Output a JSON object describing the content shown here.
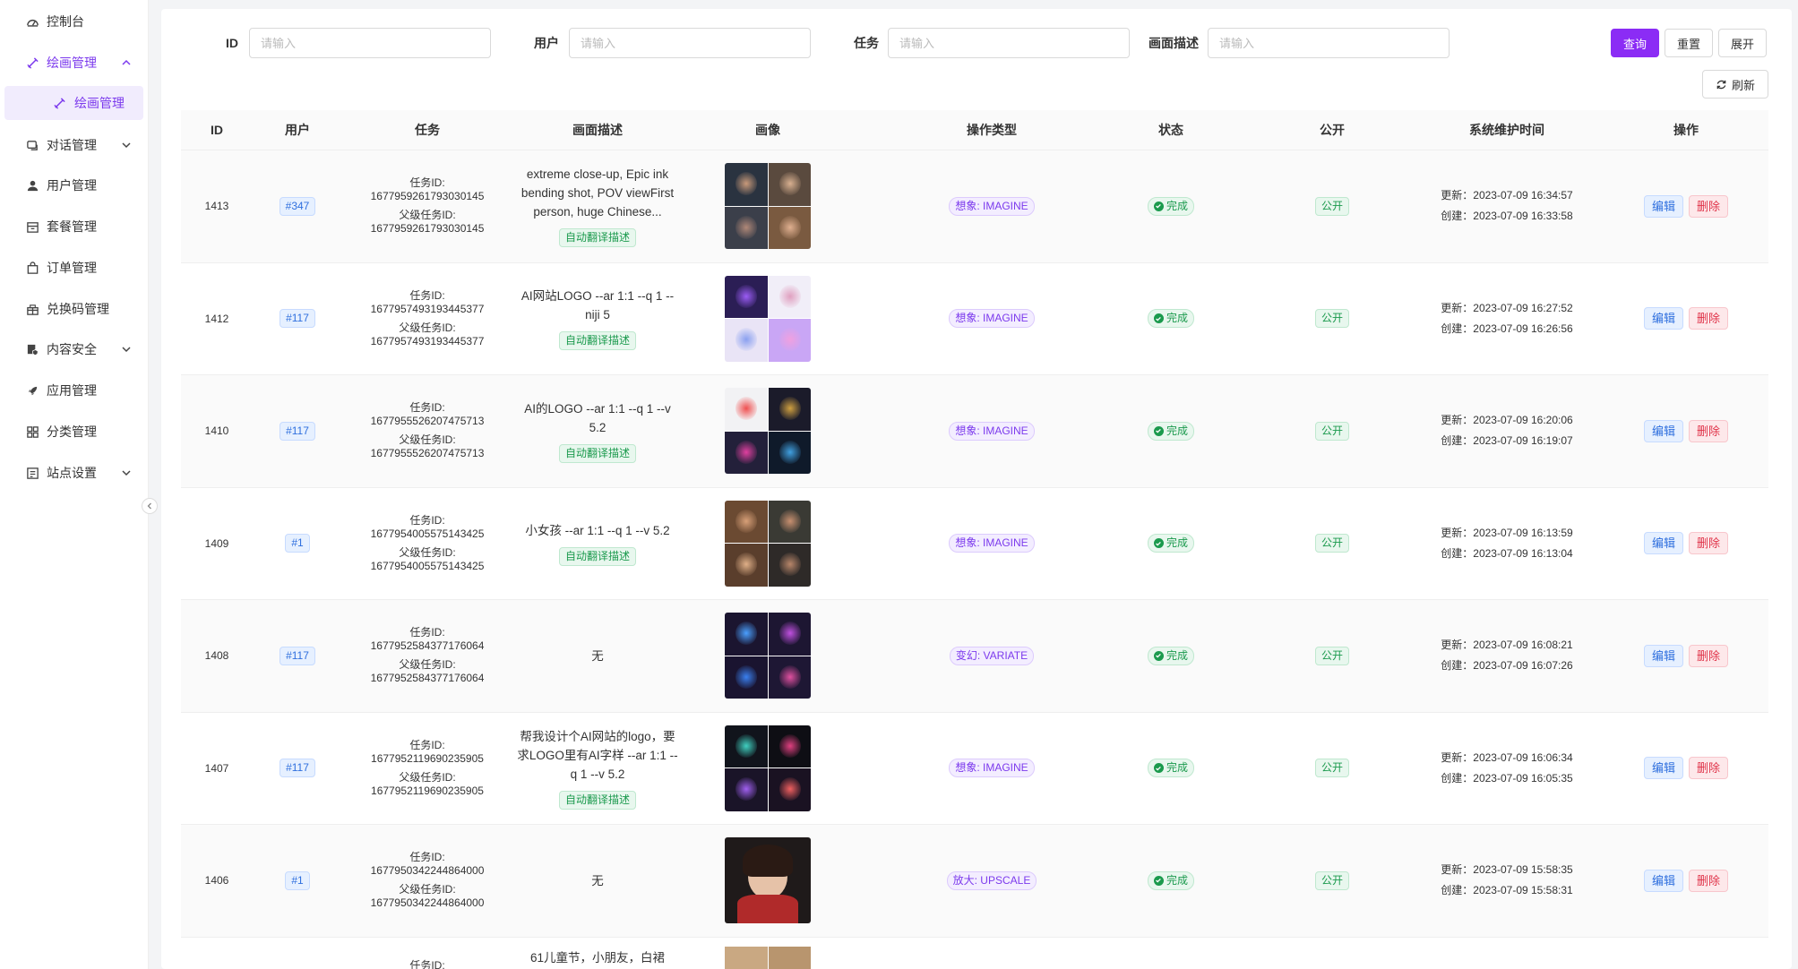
{
  "sidebar": {
    "items": [
      {
        "label": "控制台",
        "icon": "dashboard-icon"
      },
      {
        "label": "绘画管理",
        "icon": "brush-icon",
        "active": true,
        "expanded": true
      },
      {
        "label": "对话管理",
        "icon": "chat-icon",
        "has_children": true
      },
      {
        "label": "用户管理",
        "icon": "user-icon"
      },
      {
        "label": "套餐管理",
        "icon": "package-icon"
      },
      {
        "label": "订单管理",
        "icon": "bag-icon"
      },
      {
        "label": "兑换码管理",
        "icon": "gift-icon"
      },
      {
        "label": "内容安全",
        "icon": "shield-icon",
        "has_children": true
      },
      {
        "label": "应用管理",
        "icon": "rocket-icon"
      },
      {
        "label": "分类管理",
        "icon": "grid-icon"
      },
      {
        "label": "站点设置",
        "icon": "settings-icon",
        "has_children": true
      }
    ],
    "submenu_active": "绘画管理"
  },
  "filters": {
    "id_label": "ID",
    "user_label": "用户",
    "task_label": "任务",
    "desc_label": "画面描述",
    "placeholder": "请输入"
  },
  "buttons": {
    "query": "查询",
    "reset": "重置",
    "expand": "展开",
    "refresh": "刷新"
  },
  "colors": {
    "accent": "#8b2cf5",
    "success": "#1b9a4d",
    "link": "#2f6fde",
    "danger": "#e0344a"
  },
  "table": {
    "headers": [
      "ID",
      "用户",
      "任务",
      "画面描述",
      "画像",
      "操作类型",
      "状态",
      "公开",
      "系统维护时间",
      "操作"
    ],
    "task_id_label": "任务ID:",
    "parent_task_id_label": "父级任务ID:",
    "auto_translate_label": "自动翻译描述",
    "status_done": "完成",
    "public_label": "公开",
    "updated_prefix": "更新：",
    "created_prefix": "创建：",
    "edit_label": "编辑",
    "delete_label": "删除",
    "rows": [
      {
        "id": "1413",
        "user": "#347",
        "task_id": "1677959261793030145",
        "parent_task_id": "1677959261793030145",
        "desc": "extreme close-up, Epic ink bending shot, POV viewFirst person, huge Chinese...",
        "auto_translate": true,
        "op_type": "想象: IMAGINE",
        "updated": "2023-07-09 16:34:57",
        "created": "2023-07-09 16:33:58",
        "img": "portrait"
      },
      {
        "id": "1412",
        "user": "#117",
        "task_id": "1677957493193445377",
        "parent_task_id": "1677957493193445377",
        "desc": "AI网站LOGO --ar 1:1 --q 1 --niji 5",
        "auto_translate": true,
        "op_type": "想象: IMAGINE",
        "updated": "2023-07-09 16:27:52",
        "created": "2023-07-09 16:26:56",
        "img": "logo-light"
      },
      {
        "id": "1410",
        "user": "#117",
        "task_id": "1677955526207475713",
        "parent_task_id": "1677955526207475713",
        "desc": "AI的LOGO --ar 1:1 --q 1 --v 5.2",
        "auto_translate": true,
        "op_type": "想象: IMAGINE",
        "updated": "2023-07-09 16:20:06",
        "created": "2023-07-09 16:19:07",
        "img": "logo-mixed"
      },
      {
        "id": "1409",
        "user": "#1",
        "task_id": "1677954005575143425",
        "parent_task_id": "1677954005575143425",
        "desc": "小女孩 --ar 1:1 --q 1 --v 5.2",
        "auto_translate": true,
        "op_type": "想象: IMAGINE",
        "updated": "2023-07-09 16:13:59",
        "created": "2023-07-09 16:13:04",
        "img": "girls"
      },
      {
        "id": "1408",
        "user": "#117",
        "task_id": "1677952584377176064",
        "parent_task_id": "1677952584377176064",
        "desc": "无",
        "auto_translate": false,
        "op_type": "变幻: VARIATE",
        "updated": "2023-07-09 16:08:21",
        "created": "2023-07-09 16:07:26",
        "img": "logo-dark"
      },
      {
        "id": "1407",
        "user": "#117",
        "task_id": "1677952119690235905",
        "parent_task_id": "1677952119690235905",
        "desc": "帮我设计个AI网站的logo，要求LOGO里有AI字样 --ar 1:1 --q 1 --v 5.2",
        "auto_translate": true,
        "op_type": "想象: IMAGINE",
        "updated": "2023-07-09 16:06:34",
        "created": "2023-07-09 16:05:35",
        "img": "logo-dark2"
      },
      {
        "id": "1406",
        "user": "#1",
        "task_id": "1677950342244864000",
        "parent_task_id": "1677950342244864000",
        "desc": "无",
        "auto_translate": false,
        "op_type": "放大: UPSCALE",
        "updated": "2023-07-09 15:58:35",
        "created": "2023-07-09 15:58:31",
        "img": "single-girl"
      }
    ],
    "partial_row": {
      "task_label": "任务ID:",
      "desc": "61儿童节，小朋友，白裙"
    }
  }
}
